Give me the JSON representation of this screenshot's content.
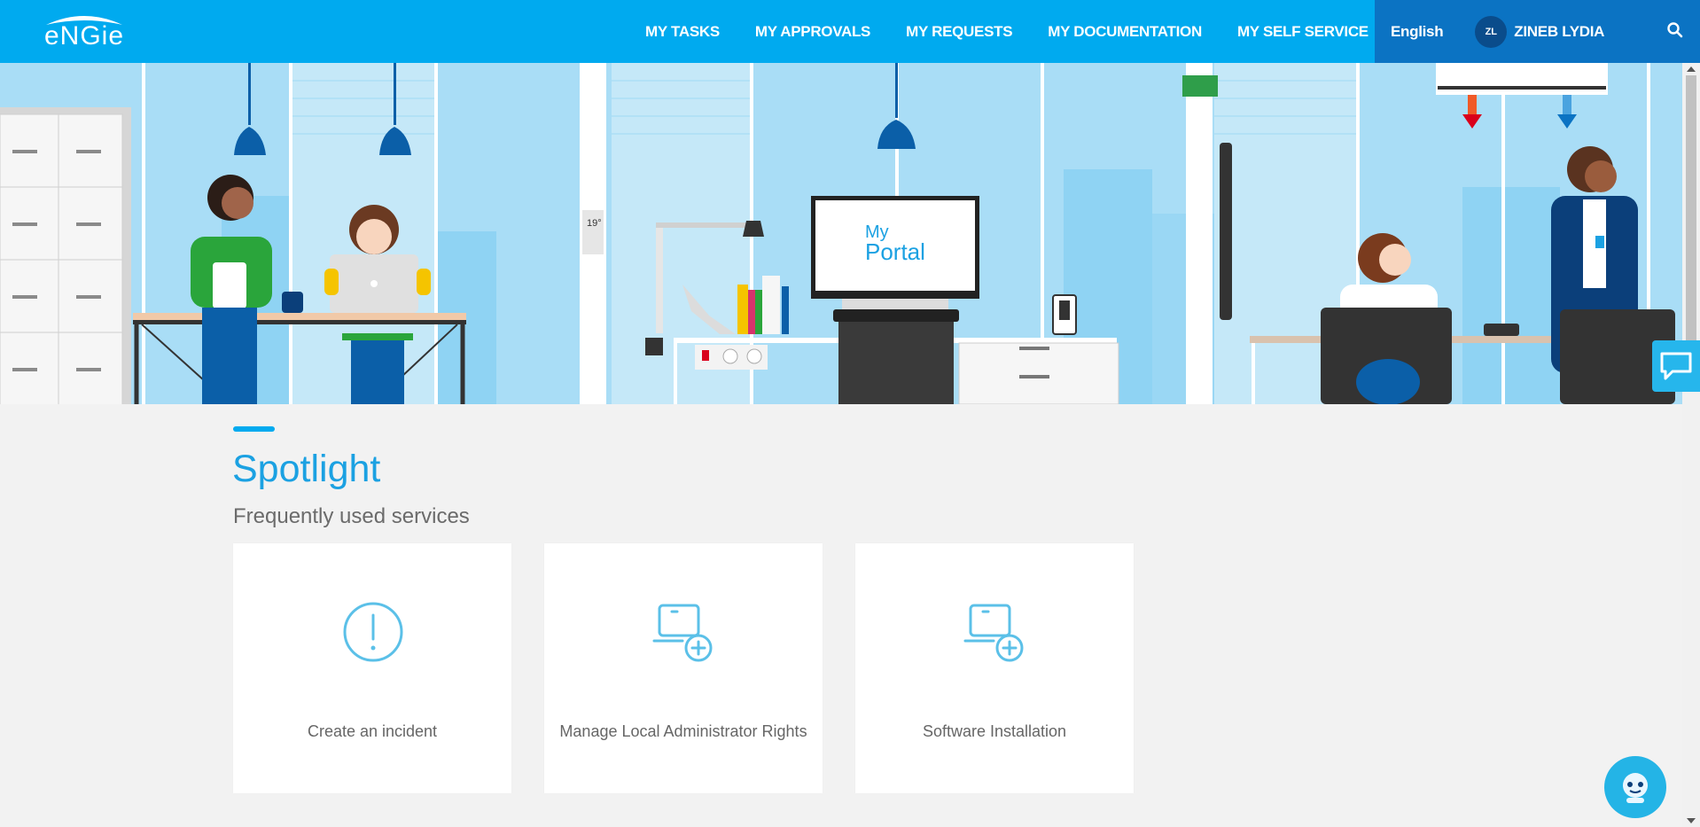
{
  "brand": {
    "logo_text": "eNGie"
  },
  "nav": [
    {
      "label": "MY TASKS"
    },
    {
      "label": "MY APPROVALS"
    },
    {
      "label": "MY REQUESTS"
    },
    {
      "label": "MY DOCUMENTATION"
    },
    {
      "label": "MY SELF SERVICE"
    }
  ],
  "user": {
    "language": "English",
    "initials": "ZL",
    "name": "ZINEB LYDIA"
  },
  "hero": {
    "monitor_text_1": "My",
    "monitor_text_2": "Portal",
    "thermostat": "19°"
  },
  "spotlight": {
    "title": "Spotlight",
    "subtitle": "Frequently used services",
    "cards": [
      {
        "label": "Create an incident",
        "icon": "alert-icon"
      },
      {
        "label": "Manage Local Administrator Rights",
        "icon": "laptop-add-icon"
      },
      {
        "label": "Software Installation",
        "icon": "laptop-add-icon"
      }
    ]
  },
  "colors": {
    "header": "#00aaef",
    "header_dark": "#0b73c3",
    "accent": "#1ba1e2"
  }
}
